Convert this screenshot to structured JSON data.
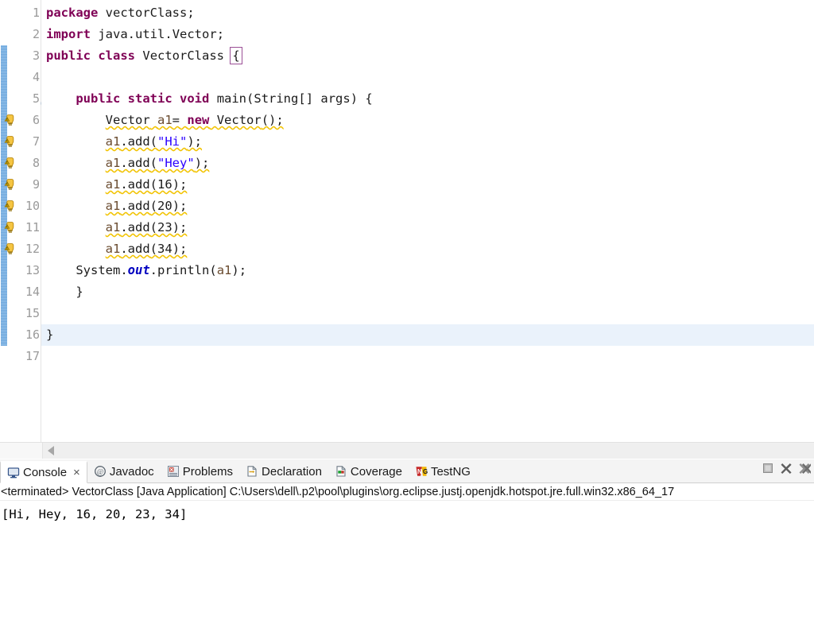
{
  "editor": {
    "first_visible_line": 1,
    "current_line": 16,
    "fold_marker_line": 5,
    "warning_lines": [
      6,
      7,
      8,
      9,
      10,
      11,
      12
    ],
    "change_bar_lines": [
      3,
      4,
      5,
      6,
      7,
      8,
      9,
      10,
      11,
      12,
      13,
      14,
      15,
      16
    ],
    "bracket_highlight": "{",
    "colors": {
      "keyword": "#7f0055",
      "string": "#2a00ff",
      "field": "#0000c0",
      "variable": "#6a4b2f",
      "plain": "#1b1b1b",
      "warning_squiggle": "#f2c300",
      "current_line_bg": "#eaf2fb",
      "change_bar": "#75aede",
      "bracket_outline": "#9b4f96",
      "line_number": "#9a9a9a"
    },
    "lines": [
      {
        "n": "1",
        "text": "package vectorClass;"
      },
      {
        "n": "2",
        "text": "import java.util.Vector;"
      },
      {
        "n": "3",
        "text": "public class VectorClass {"
      },
      {
        "n": "4",
        "text": ""
      },
      {
        "n": "5",
        "text": "    public static void main(String[] args) {"
      },
      {
        "n": "6",
        "text": "        Vector a1= new Vector();"
      },
      {
        "n": "7",
        "text": "        a1.add(\"Hi\");"
      },
      {
        "n": "8",
        "text": "        a1.add(\"Hey\");"
      },
      {
        "n": "9",
        "text": "        a1.add(16);"
      },
      {
        "n": "10",
        "text": "        a1.add(20);"
      },
      {
        "n": "11",
        "text": "        a1.add(23);"
      },
      {
        "n": "12",
        "text": "        a1.add(34);"
      },
      {
        "n": "13",
        "text": "    System.out.println(a1);"
      },
      {
        "n": "14",
        "text": "    }"
      },
      {
        "n": "15",
        "text": ""
      },
      {
        "n": "16",
        "text": "}"
      },
      {
        "n": "17",
        "text": ""
      }
    ],
    "hscroll": {
      "left_arrow": "scroll-left-arrow"
    }
  },
  "bottom_panel": {
    "tabs": [
      {
        "label": "Console",
        "icon": "console-icon",
        "active": true,
        "closable": true,
        "close_label": "×"
      },
      {
        "label": "Javadoc",
        "icon": "javadoc-icon",
        "active": false,
        "closable": false
      },
      {
        "label": "Problems",
        "icon": "problems-icon",
        "active": false,
        "closable": false
      },
      {
        "label": "Declaration",
        "icon": "declaration-icon",
        "active": false,
        "closable": false
      },
      {
        "label": "Coverage",
        "icon": "coverage-icon",
        "active": false,
        "closable": false
      },
      {
        "label": "TestNG",
        "icon": "testng-icon",
        "active": false,
        "closable": false
      }
    ],
    "toolbar_buttons": [
      {
        "name": "terminate-button",
        "icon": "stop-square-icon"
      },
      {
        "name": "remove-launch-button",
        "icon": "remove-x-icon"
      },
      {
        "name": "remove-all-button",
        "icon": "remove-all-x-icon"
      }
    ],
    "terminated_line": "<terminated> VectorClass [Java Application] C:\\Users\\dell\\.p2\\pool\\plugins\\org.eclipse.justj.openjdk.hotspot.jre.full.win32.x86_64_17",
    "console_output": "[Hi, Hey, 16, 20, 23, 34]"
  }
}
